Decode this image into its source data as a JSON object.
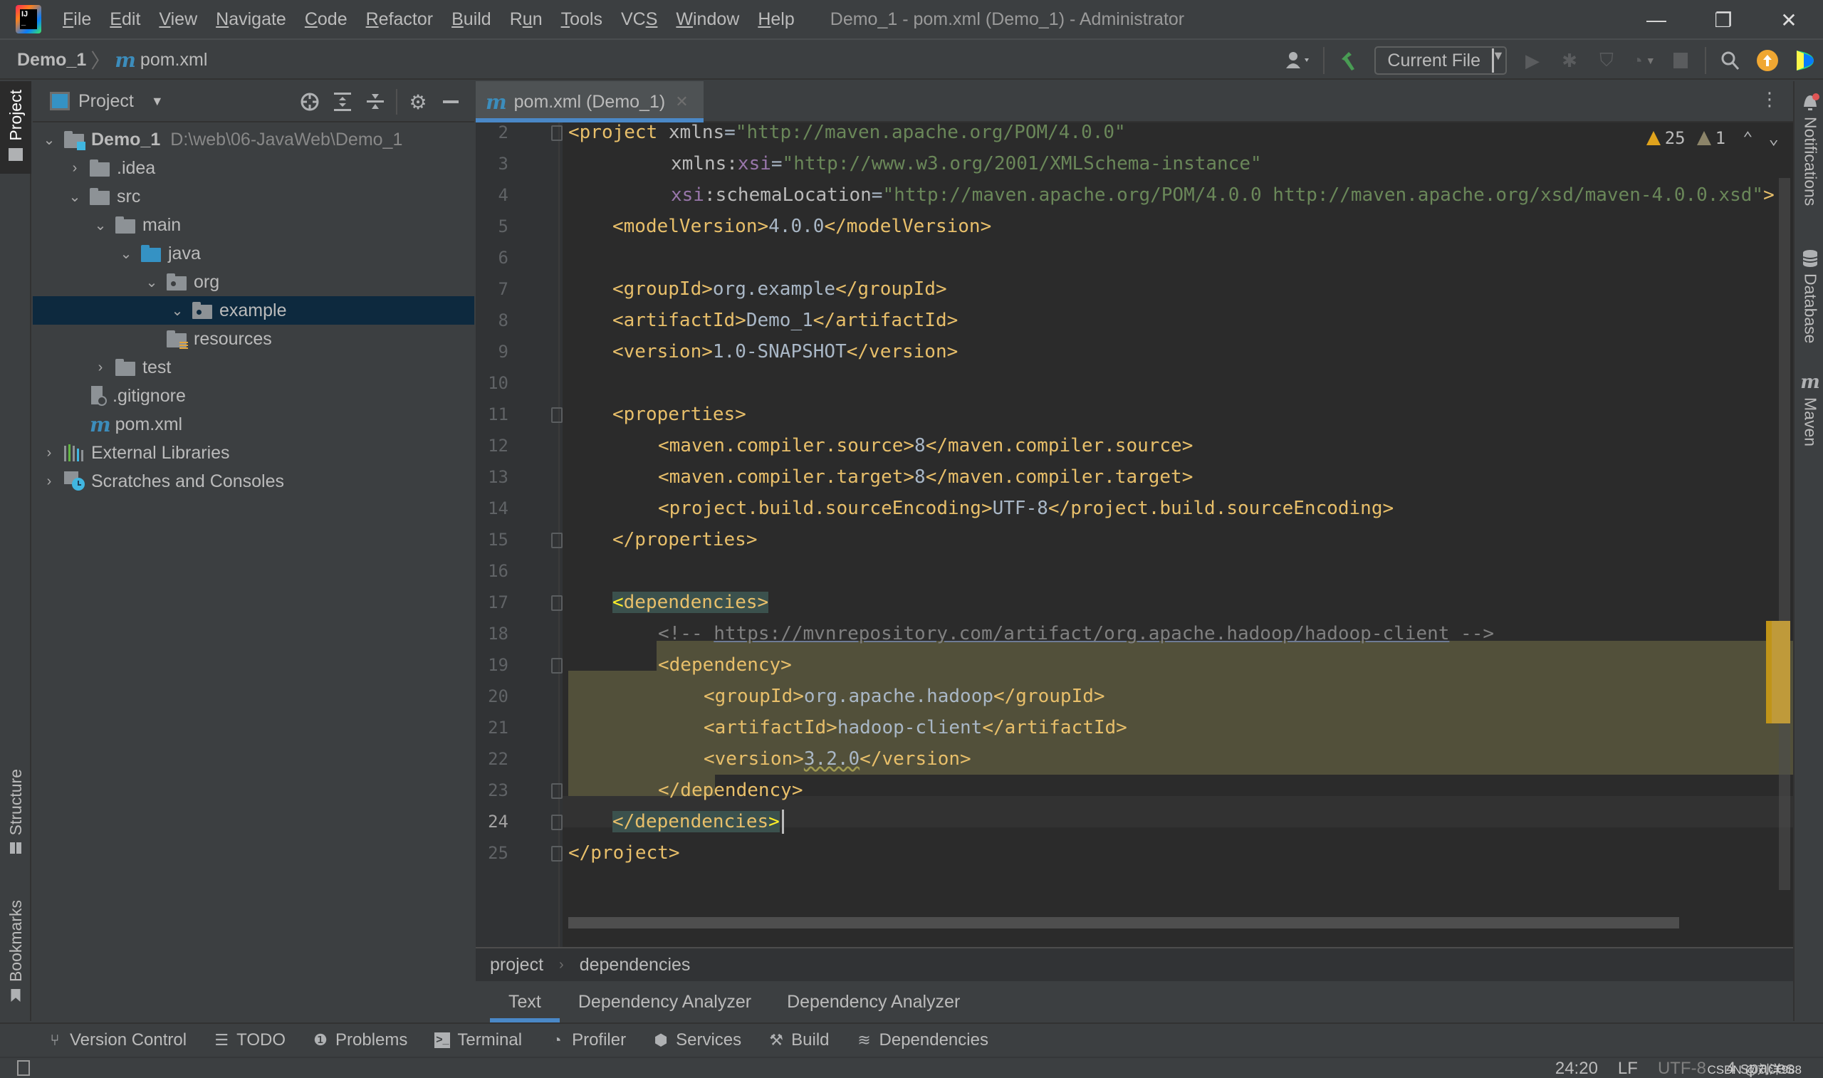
{
  "window": {
    "title": "Demo_1 - pom.xml (Demo_1) - Administrator",
    "controls": {
      "minimize": "—",
      "restore": "❐",
      "close": "✕"
    }
  },
  "menu": [
    {
      "label": "File",
      "mnemonic": "F",
      "rest": "ile"
    },
    {
      "label": "Edit",
      "mnemonic": "E",
      "rest": "dit"
    },
    {
      "label": "View",
      "mnemonic": "V",
      "rest": "iew"
    },
    {
      "label": "Navigate",
      "mnemonic": "N",
      "rest": "avigate"
    },
    {
      "label": "Code",
      "mnemonic": "C",
      "rest": "ode"
    },
    {
      "label": "Refactor",
      "mnemonic": "R",
      "rest": "efactor"
    },
    {
      "label": "Build",
      "mnemonic": "B",
      "rest": "uild"
    },
    {
      "label": "Run",
      "mnemonic": "R",
      "pre": "R",
      "mid": "u",
      "post": "n"
    },
    {
      "label": "Tools",
      "mnemonic": "T",
      "rest": "ools"
    },
    {
      "label": "VCS",
      "pre": "VC",
      "mid": "S",
      "post": ""
    },
    {
      "label": "Window",
      "mnemonic": "W",
      "rest": "indow"
    },
    {
      "label": "Help",
      "mnemonic": "H",
      "rest": "elp"
    }
  ],
  "navbar": {
    "project": "Demo_1",
    "separator": "〉",
    "file_icon": "m",
    "file": "pom.xml",
    "run_config": "Current File"
  },
  "left_stripe": {
    "project": "Project",
    "structure": "Structure",
    "bookmarks": "Bookmarks"
  },
  "right_stripe": {
    "notifications": "Notifications",
    "database": "Database",
    "maven": "Maven"
  },
  "project_panel": {
    "title": "Project",
    "tree": [
      {
        "label": "Demo_1",
        "hint": "D:\\web\\06-JavaWeb\\Demo_1",
        "depth": 0,
        "expanded": true,
        "icon": "module-folder"
      },
      {
        "label": ".idea",
        "depth": 1,
        "expanded": false,
        "icon": "folder"
      },
      {
        "label": "src",
        "depth": 1,
        "expanded": true,
        "icon": "folder"
      },
      {
        "label": "main",
        "depth": 2,
        "expanded": true,
        "icon": "folder"
      },
      {
        "label": "java",
        "depth": 3,
        "expanded": true,
        "icon": "source-folder"
      },
      {
        "label": "org",
        "depth": 4,
        "expanded": true,
        "icon": "package"
      },
      {
        "label": "example",
        "depth": 5,
        "expanded": true,
        "icon": "package",
        "selected": true
      },
      {
        "label": "resources",
        "depth": 4,
        "icon": "resources-folder"
      },
      {
        "label": "test",
        "depth": 2,
        "expanded": false,
        "icon": "folder"
      },
      {
        "label": ".gitignore",
        "depth": 1,
        "icon": "ignore-file"
      },
      {
        "label": "pom.xml",
        "depth": 1,
        "icon": "maven-file"
      },
      {
        "label": "External Libraries",
        "depth": 0,
        "expanded": false,
        "icon": "libraries"
      },
      {
        "label": "Scratches and Consoles",
        "depth": 0,
        "expanded": false,
        "icon": "scratches"
      }
    ]
  },
  "editor": {
    "tab": {
      "label": "pom.xml (Demo_1)",
      "icon": "m",
      "close": "✕"
    },
    "problems": {
      "warnings": "25",
      "weak_warnings": "1"
    },
    "lines": [
      {
        "n": "2"
      },
      {
        "n": "3"
      },
      {
        "n": "4"
      },
      {
        "n": "5"
      },
      {
        "n": "6"
      },
      {
        "n": "7"
      },
      {
        "n": "8"
      },
      {
        "n": "9"
      },
      {
        "n": "10"
      },
      {
        "n": "11"
      },
      {
        "n": "12"
      },
      {
        "n": "13"
      },
      {
        "n": "14"
      },
      {
        "n": "15"
      },
      {
        "n": "16"
      },
      {
        "n": "17"
      },
      {
        "n": "18"
      },
      {
        "n": "19"
      },
      {
        "n": "20"
      },
      {
        "n": "21"
      },
      {
        "n": "22"
      },
      {
        "n": "23"
      },
      {
        "n": "24",
        "current": true
      },
      {
        "n": "25"
      }
    ],
    "code": {
      "l2": {
        "open": "<project ",
        "attr": "xmlns",
        "eq": "=",
        "val": "\"http://maven.apache.org/POM/4.0.0\""
      },
      "l3": {
        "attr": "xmlns:",
        "ns": "xsi",
        "eq": "=",
        "val": "\"http://www.w3.org/2001/XMLSchema-instance\""
      },
      "l4": {
        "ns": "xsi",
        "attr": ":schemaLocation",
        "eq": "=",
        "val": "\"http://maven.apache.org/POM/4.0.0 http://maven.apache.org/xsd/maven-4.0.0.xsd\"",
        "close": ">"
      },
      "l5": {
        "open": "<modelVersion>",
        "text": "4.0.0",
        "close": "</modelVersion>"
      },
      "l7": {
        "open": "<groupId>",
        "text": "org.example",
        "close": "</groupId>"
      },
      "l8": {
        "open": "<artifactId>",
        "text": "Demo_1",
        "close": "</artifactId>"
      },
      "l9": {
        "open": "<version>",
        "text": "1.0-SNAPSHOT",
        "close": "</version>"
      },
      "l11": {
        "open": "<properties>"
      },
      "l12": {
        "open": "<maven.compiler.source>",
        "text": "8",
        "close": "</maven.compiler.source>"
      },
      "l13": {
        "open": "<maven.compiler.target>",
        "text": "8",
        "close": "</maven.compiler.target>"
      },
      "l14": {
        "open": "<project.build.sourceEncoding>",
        "text": "UTF-8",
        "close": "</project.build.sourceEncoding>"
      },
      "l15": {
        "close": "</properties>"
      },
      "l17": {
        "lt": "<",
        "open": "dependencies>"
      },
      "l18": {
        "start": "<!-- ",
        "link": "https://mvnrepository.com/artifact/org.apache.hadoop/hadoop-client",
        "end": " -->"
      },
      "l19": {
        "open": "<dependency>"
      },
      "l20": {
        "open": "<groupId>",
        "text": "org.apache.hadoop",
        "close": "</groupId>"
      },
      "l21": {
        "open": "<artifactId>",
        "text": "hadoop-client",
        "close": "</artifactId>"
      },
      "l22": {
        "open": "<version>",
        "text": "3.2.0",
        "close": "</version>"
      },
      "l23": {
        "close": "</dependency>"
      },
      "l24": {
        "close": "</dependencies",
        "gt": ">"
      },
      "l25": {
        "close": "</project>"
      }
    }
  },
  "breadcrumbs": [
    "project",
    "dependencies"
  ],
  "breadcrumb_separator": "›",
  "editor_bottom_tabs": [
    "Text",
    "Dependency Analyzer",
    "Dependency Analyzer"
  ],
  "tool_windows": [
    {
      "label": "Version Control",
      "icon": "vcs-branch-icon"
    },
    {
      "label": "TODO",
      "icon": "todo-list-icon"
    },
    {
      "label": "Problems",
      "icon": "problems-icon"
    },
    {
      "label": "Terminal",
      "icon": "terminal-icon"
    },
    {
      "label": "Profiler",
      "icon": "profiler-icon"
    },
    {
      "label": "Services",
      "icon": "services-icon"
    },
    {
      "label": "Build",
      "icon": "hammer-icon"
    },
    {
      "label": "Dependencies",
      "icon": "dependencies-icon"
    }
  ],
  "status": {
    "position": "24:20",
    "line_separator": "LF",
    "encoding": "UTF-8",
    "indent": "4 spaces",
    "watermark": "CSDN @刘洋988"
  },
  "colors": {
    "accent": "#4a88c7",
    "tag": "#e8bf6a",
    "attr_value": "#6a8759",
    "namespace": "#9876aa",
    "selection": "#52503a",
    "tree_selection": "#0d293e",
    "warning": "#e0a31d"
  }
}
